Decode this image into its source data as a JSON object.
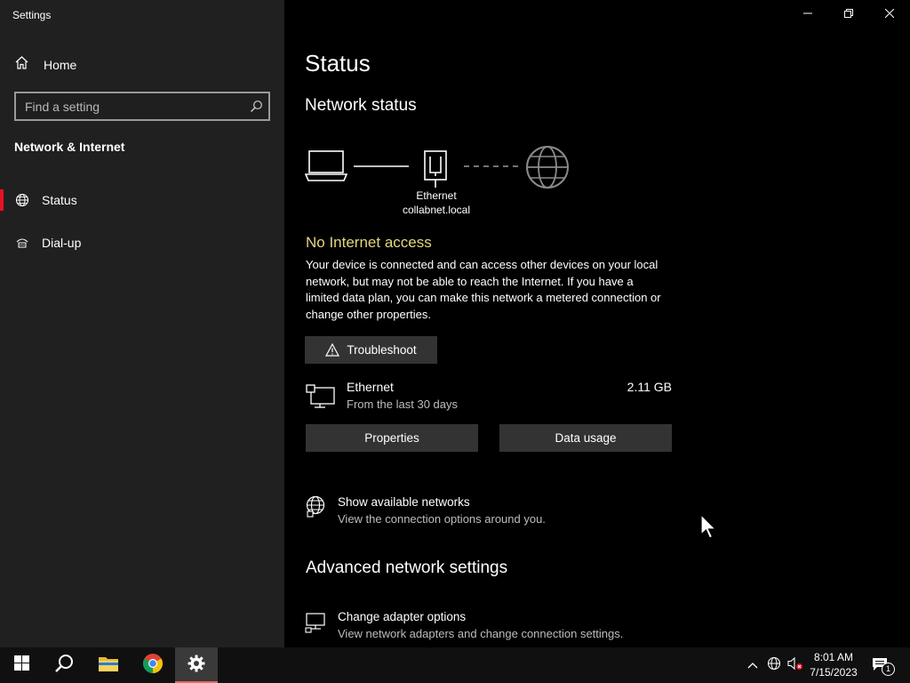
{
  "window": {
    "title": "Settings",
    "controls": {
      "minimize": "minimize-icon",
      "restore": "restore-icon",
      "close": "close-icon"
    }
  },
  "sidebar": {
    "home_label": "Home",
    "search_placeholder": "Find a setting",
    "section_title": "Network & Internet",
    "items": [
      {
        "label": "Status",
        "icon": "globe-network-icon",
        "selected": true
      },
      {
        "label": "Dial-up",
        "icon": "dialup-icon",
        "selected": false
      }
    ],
    "accent_color": "#e81123"
  },
  "main": {
    "title": "Status",
    "network_status_heading": "Network status",
    "diagram": {
      "adapter_name": "Ethernet",
      "network_name": "collabnet.local"
    },
    "status_heading": "No Internet access",
    "status_color": "#e3d680",
    "description": "Your device is connected and can access other devices on your local network, but may not be able to reach the Internet. If you have a limited data plan, you can make this network a metered connection or change other properties.",
    "troubleshoot_label": "Troubleshoot",
    "ethernet": {
      "name": "Ethernet",
      "subtitle": "From the last 30 days",
      "usage": "2.11 GB"
    },
    "properties_label": "Properties",
    "data_usage_label": "Data usage",
    "show_networks": {
      "title": "Show available networks",
      "subtitle": "View the connection options around you."
    },
    "advanced_heading": "Advanced network settings",
    "change_adapter": {
      "title": "Change adapter options",
      "subtitle": "View network adapters and change connection settings."
    }
  },
  "taskbar": {
    "apps": [
      "start-icon",
      "search-icon",
      "file-explorer-icon",
      "chrome-icon",
      "settings-gear-icon"
    ],
    "active_app": "settings-gear-icon",
    "clock_time": "8:01 AM",
    "clock_date": "7/15/2023",
    "notification_count": "1"
  }
}
